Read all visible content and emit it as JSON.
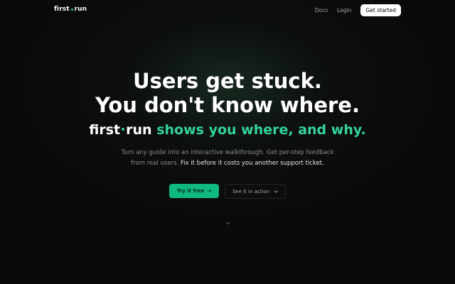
{
  "header": {
    "logo_left": "first",
    "logo_right": "run",
    "nav": {
      "docs": "Docs",
      "login": "Login",
      "cta": "Get started"
    }
  },
  "hero": {
    "line1": "Users get stuck.",
    "line2": "You don't know where.",
    "brand_left": "first",
    "brand_right": "run",
    "tagline": "shows you where, and why.",
    "sub_line1": "Turn any guide into an interactive walkthrough. Get per-step feedback",
    "sub_line2_muted": "from real users.",
    "sub_line2_highlight": "Fix it before it costs you another support ticket."
  },
  "actions": {
    "primary": "Try it free",
    "secondary": "See it in action"
  },
  "icons": {
    "primary_arrow": "arrow-right-icon",
    "secondary_chevron": "chevron-down-icon",
    "scroll": "chevron-down-icon"
  },
  "colors": {
    "background": "#0a0a0a",
    "accent": "#34d399",
    "button_primary": "#10b981"
  }
}
